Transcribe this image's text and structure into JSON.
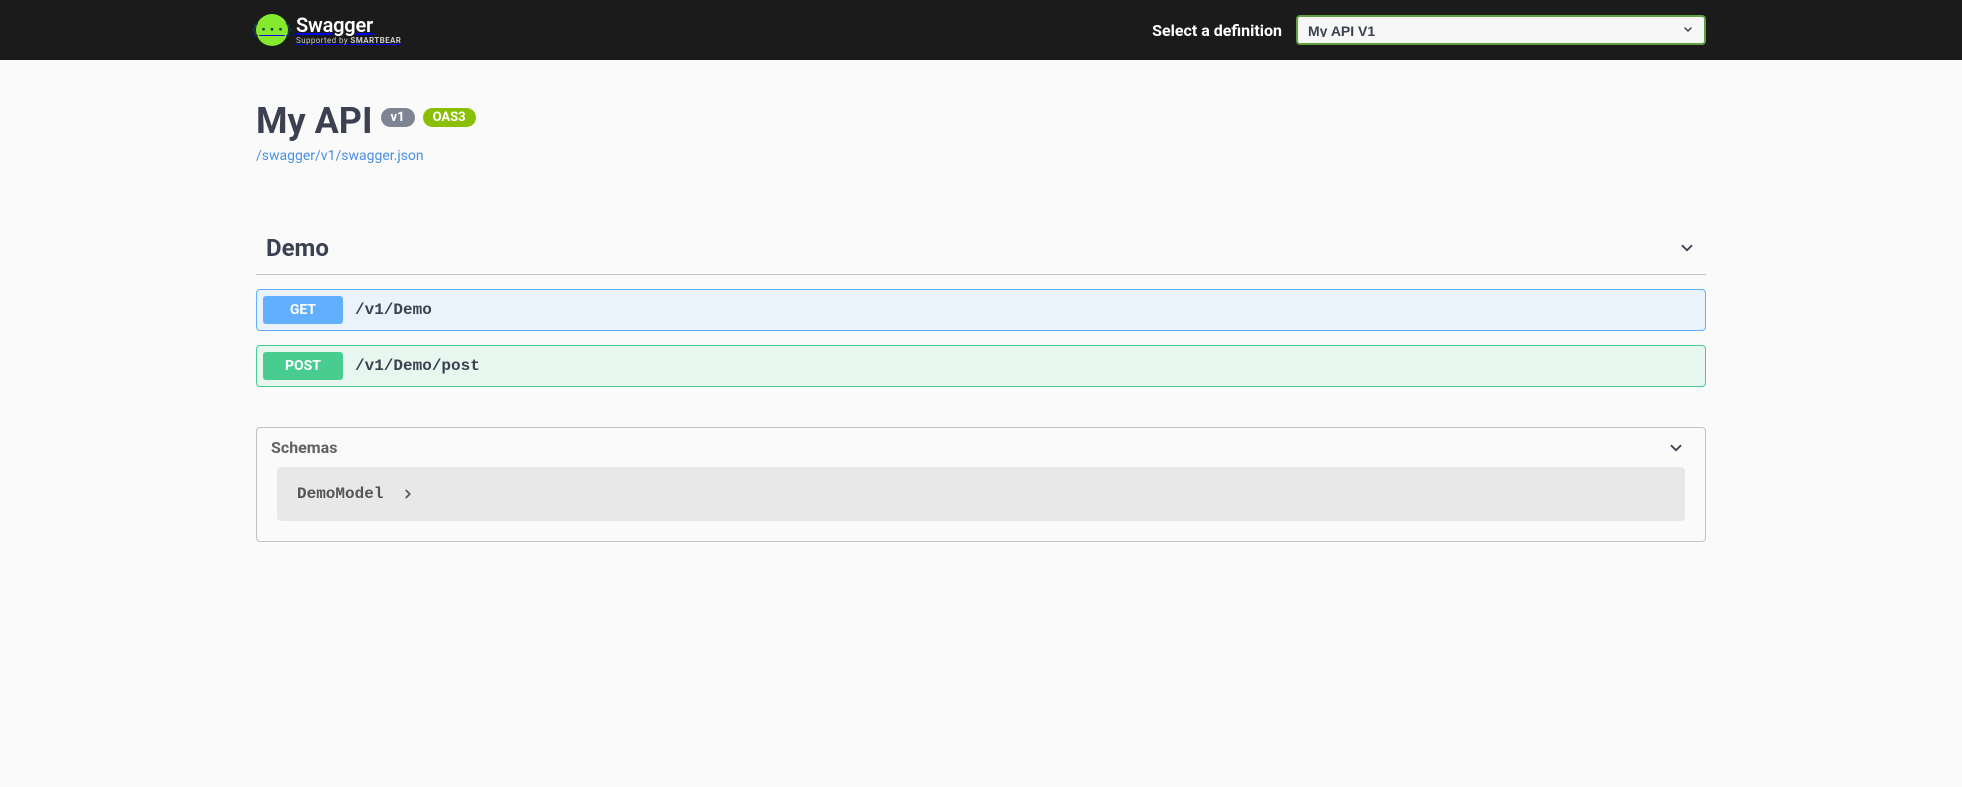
{
  "topbar": {
    "logo_text": "Swagger",
    "logo_subtext_prefix": "Supported by ",
    "logo_subtext_brand": "SMARTBEAR",
    "logo_glyph": "{···}",
    "select_label": "Select a definition",
    "selected_definition": "My API V1"
  },
  "info": {
    "title": "My API",
    "version_badge": "v1",
    "oas_badge": "OAS3",
    "spec_url": "/swagger/v1/swagger.json"
  },
  "tags": [
    {
      "name": "Demo",
      "operations": [
        {
          "method": "GET",
          "path": "/v1/Demo"
        },
        {
          "method": "POST",
          "path": "/v1/Demo/post"
        }
      ]
    }
  ],
  "schemas": {
    "title": "Schemas",
    "items": [
      {
        "name": "DemoModel"
      }
    ]
  }
}
